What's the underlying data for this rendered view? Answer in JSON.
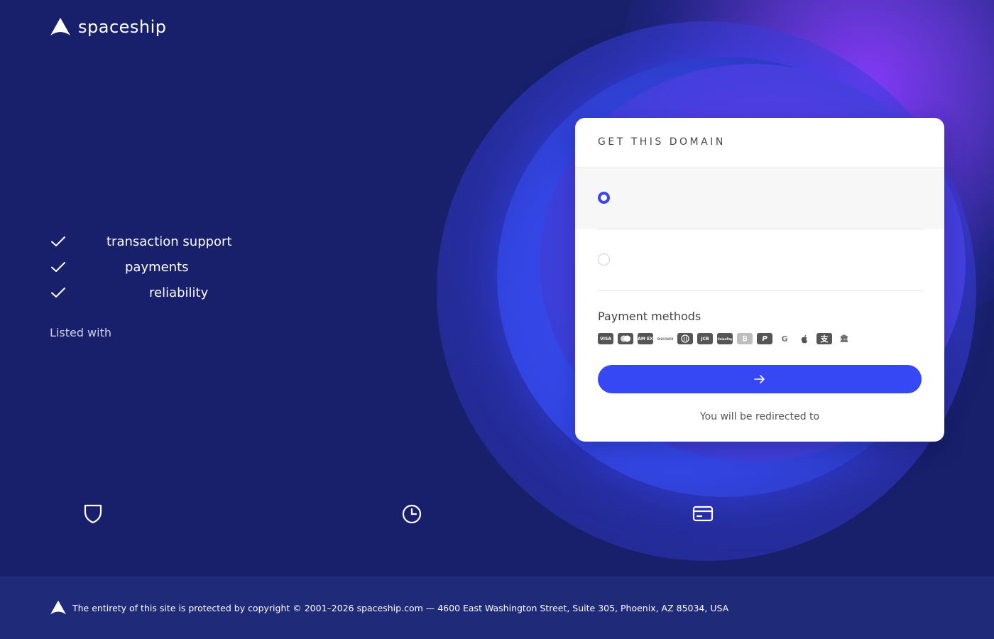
{
  "brand": {
    "name": "spaceship"
  },
  "features": [
    {
      "text": "transaction support"
    },
    {
      "text": "payments"
    },
    {
      "text": "reliability"
    }
  ],
  "listed_with": "Listed with",
  "card": {
    "title": "GET THIS DOMAIN",
    "options": [
      {
        "selected": true
      },
      {
        "selected": false
      }
    ],
    "payment_methods_label": "Payment methods",
    "payment_icons": [
      "visa-icon",
      "mastercard-icon",
      "amex-icon",
      "discover-icon",
      "diners-icon",
      "jcb-icon",
      "unionpay-icon",
      "bitcoin-icon",
      "paypal-icon",
      "google-pay-icon",
      "apple-pay-icon",
      "alipay-icon",
      "bank-transfer-icon"
    ],
    "payment_icon_labels": {
      "visa": "VISA",
      "amex": "AM EX",
      "discover": "DISCOVER",
      "jcb": "JCB",
      "unionpay": "UnionPay",
      "bitcoin": "₿",
      "paypal": "P",
      "google": "G",
      "apple": "",
      "alipay": "支",
      "bank": "🏛"
    },
    "cta_icon": "arrow-right-icon",
    "redirect_text": "You will be redirected to"
  },
  "bottom_icons": [
    "shield-icon",
    "clock-icon",
    "credit-card-icon"
  ],
  "footer": {
    "text": "The entirety of this site is protected by copyright © 2001–2026 spaceship.com — 4600 East Washington Street, Suite 305, Phoenix, AZ 85034, USA"
  },
  "colors": {
    "background": "#18206b",
    "accent": "#3548f4",
    "glow": "#8c3cff",
    "card": "#ffffff"
  }
}
